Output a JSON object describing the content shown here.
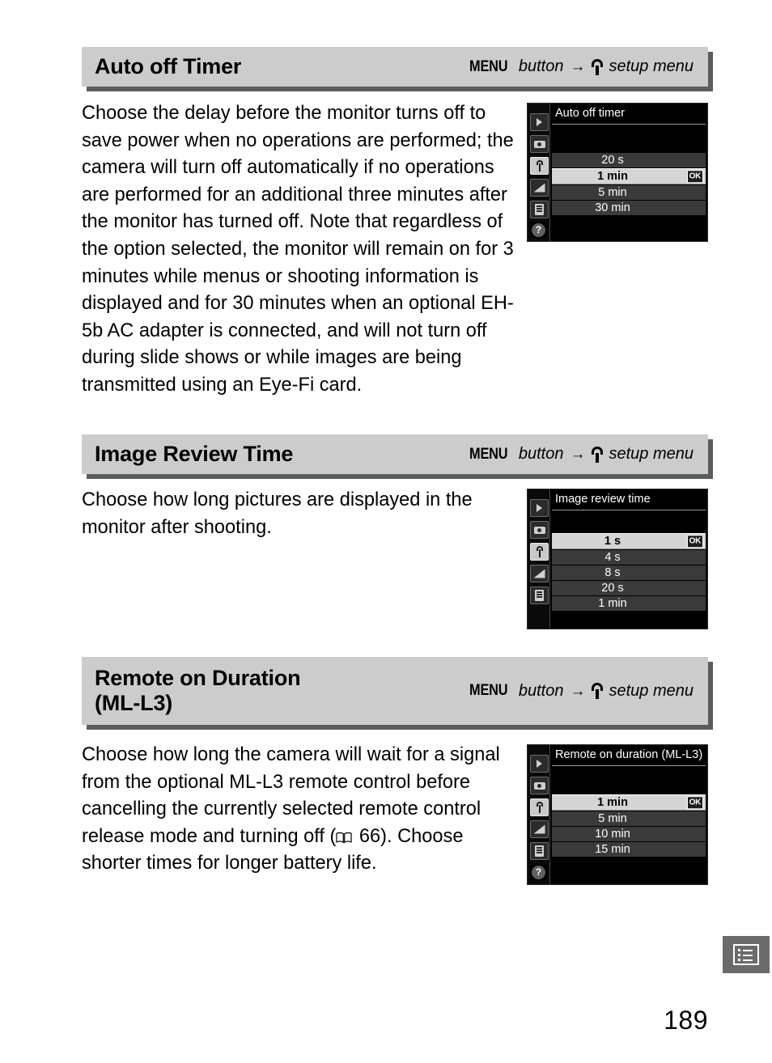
{
  "page": {
    "number": "189",
    "tab_marker_icon": "menu-list-icon"
  },
  "menu_path": {
    "menu_word": "MENU",
    "button_word": "button",
    "arrow": "→",
    "icon": "wrench-icon",
    "destination": "setup menu"
  },
  "sections": [
    {
      "id": "auto-off-timer",
      "title": "Auto off Timer",
      "body": "Choose the delay before the monitor turns off to save power when no operations are performed; the camera will turn off automatically if no operations are performed for an additional three minutes after the monitor has turned off.  Note that regardless of the option selected, the monitor will remain on for 3 minutes while menus or shooting information is displayed and for 30 minutes when an optional EH-5b AC adapter is connected, and will not turn off during slide shows or while images are being transmitted using an Eye-Fi card.",
      "screen": {
        "title": "Auto off timer",
        "has_help_icon": true,
        "ok_label": "OK",
        "options": [
          {
            "label": "20 s",
            "selected": false
          },
          {
            "label": "1 min",
            "selected": true
          },
          {
            "label": "5 min",
            "selected": false
          },
          {
            "label": "30 min",
            "selected": false
          }
        ]
      }
    },
    {
      "id": "image-review-time",
      "title": "Image Review Time",
      "body": "Choose how long pictures are displayed in the monitor after shooting.",
      "screen": {
        "title": "Image review time",
        "has_help_icon": false,
        "ok_label": "OK",
        "options": [
          {
            "label": "1 s",
            "selected": true
          },
          {
            "label": "4 s",
            "selected": false
          },
          {
            "label": "8 s",
            "selected": false
          },
          {
            "label": "20 s",
            "selected": false
          },
          {
            "label": "1 min",
            "selected": false
          }
        ]
      }
    },
    {
      "id": "remote-on-duration",
      "title": "Remote on Duration\n(ML-L3)",
      "body_part1": "Choose how long the camera will wait for a signal from the optional ML-L3 remote control before cancelling the currently selected remote control release mode and turning off (",
      "body_ref": " 66).",
      "body_part2": "  Choose shorter times for longer battery life.",
      "screen": {
        "title": "Remote on duration (ML-L3)",
        "has_help_icon": true,
        "ok_label": "OK",
        "options": [
          {
            "label": "1 min",
            "selected": true
          },
          {
            "label": "5 min",
            "selected": false
          },
          {
            "label": "10 min",
            "selected": false
          },
          {
            "label": "15 min",
            "selected": false
          }
        ]
      }
    }
  ],
  "lcd_sidebar_icons": [
    "playback-icon",
    "shooting-menu-icon",
    "setup-menu-icon",
    "custom-settings-icon",
    "retouch-menu-icon"
  ],
  "colors": {
    "header_bg": "#cccccc",
    "header_shadow": "#5a5d5e",
    "lcd_bg": "#000000",
    "lcd_row": "#3a3a3a",
    "lcd_row_selected": "#d5d5d5",
    "tab_marker": "#6b6b6b"
  }
}
